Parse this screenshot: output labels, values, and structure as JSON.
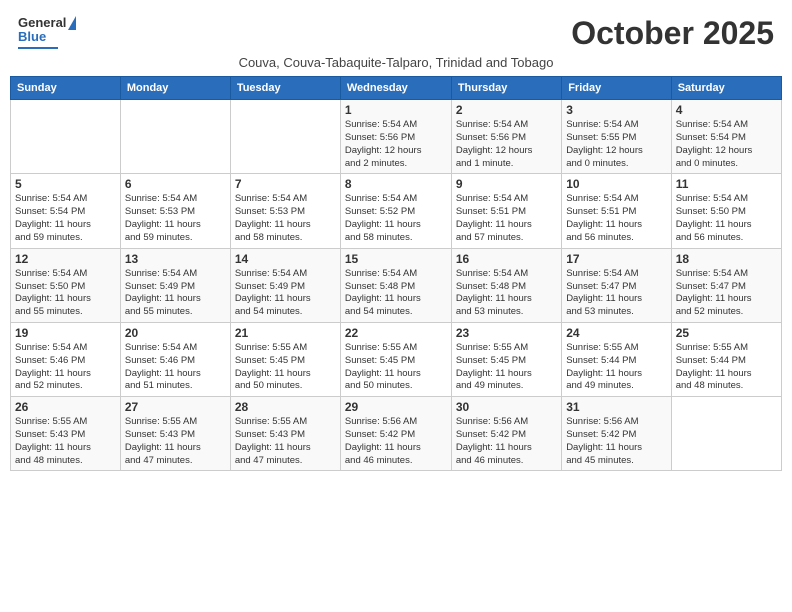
{
  "header": {
    "logo_line1": "General",
    "logo_line2": "Blue",
    "month": "October 2025",
    "subtitle": "Couva, Couva-Tabaquite-Talparo, Trinidad and Tobago"
  },
  "weekdays": [
    "Sunday",
    "Monday",
    "Tuesday",
    "Wednesday",
    "Thursday",
    "Friday",
    "Saturday"
  ],
  "weeks": [
    [
      {
        "day": "",
        "info": ""
      },
      {
        "day": "",
        "info": ""
      },
      {
        "day": "",
        "info": ""
      },
      {
        "day": "1",
        "info": "Sunrise: 5:54 AM\nSunset: 5:56 PM\nDaylight: 12 hours\nand 2 minutes."
      },
      {
        "day": "2",
        "info": "Sunrise: 5:54 AM\nSunset: 5:56 PM\nDaylight: 12 hours\nand 1 minute."
      },
      {
        "day": "3",
        "info": "Sunrise: 5:54 AM\nSunset: 5:55 PM\nDaylight: 12 hours\nand 0 minutes."
      },
      {
        "day": "4",
        "info": "Sunrise: 5:54 AM\nSunset: 5:54 PM\nDaylight: 12 hours\nand 0 minutes."
      }
    ],
    [
      {
        "day": "5",
        "info": "Sunrise: 5:54 AM\nSunset: 5:54 PM\nDaylight: 11 hours\nand 59 minutes."
      },
      {
        "day": "6",
        "info": "Sunrise: 5:54 AM\nSunset: 5:53 PM\nDaylight: 11 hours\nand 59 minutes."
      },
      {
        "day": "7",
        "info": "Sunrise: 5:54 AM\nSunset: 5:53 PM\nDaylight: 11 hours\nand 58 minutes."
      },
      {
        "day": "8",
        "info": "Sunrise: 5:54 AM\nSunset: 5:52 PM\nDaylight: 11 hours\nand 58 minutes."
      },
      {
        "day": "9",
        "info": "Sunrise: 5:54 AM\nSunset: 5:51 PM\nDaylight: 11 hours\nand 57 minutes."
      },
      {
        "day": "10",
        "info": "Sunrise: 5:54 AM\nSunset: 5:51 PM\nDaylight: 11 hours\nand 56 minutes."
      },
      {
        "day": "11",
        "info": "Sunrise: 5:54 AM\nSunset: 5:50 PM\nDaylight: 11 hours\nand 56 minutes."
      }
    ],
    [
      {
        "day": "12",
        "info": "Sunrise: 5:54 AM\nSunset: 5:50 PM\nDaylight: 11 hours\nand 55 minutes."
      },
      {
        "day": "13",
        "info": "Sunrise: 5:54 AM\nSunset: 5:49 PM\nDaylight: 11 hours\nand 55 minutes."
      },
      {
        "day": "14",
        "info": "Sunrise: 5:54 AM\nSunset: 5:49 PM\nDaylight: 11 hours\nand 54 minutes."
      },
      {
        "day": "15",
        "info": "Sunrise: 5:54 AM\nSunset: 5:48 PM\nDaylight: 11 hours\nand 54 minutes."
      },
      {
        "day": "16",
        "info": "Sunrise: 5:54 AM\nSunset: 5:48 PM\nDaylight: 11 hours\nand 53 minutes."
      },
      {
        "day": "17",
        "info": "Sunrise: 5:54 AM\nSunset: 5:47 PM\nDaylight: 11 hours\nand 53 minutes."
      },
      {
        "day": "18",
        "info": "Sunrise: 5:54 AM\nSunset: 5:47 PM\nDaylight: 11 hours\nand 52 minutes."
      }
    ],
    [
      {
        "day": "19",
        "info": "Sunrise: 5:54 AM\nSunset: 5:46 PM\nDaylight: 11 hours\nand 52 minutes."
      },
      {
        "day": "20",
        "info": "Sunrise: 5:54 AM\nSunset: 5:46 PM\nDaylight: 11 hours\nand 51 minutes."
      },
      {
        "day": "21",
        "info": "Sunrise: 5:55 AM\nSunset: 5:45 PM\nDaylight: 11 hours\nand 50 minutes."
      },
      {
        "day": "22",
        "info": "Sunrise: 5:55 AM\nSunset: 5:45 PM\nDaylight: 11 hours\nand 50 minutes."
      },
      {
        "day": "23",
        "info": "Sunrise: 5:55 AM\nSunset: 5:45 PM\nDaylight: 11 hours\nand 49 minutes."
      },
      {
        "day": "24",
        "info": "Sunrise: 5:55 AM\nSunset: 5:44 PM\nDaylight: 11 hours\nand 49 minutes."
      },
      {
        "day": "25",
        "info": "Sunrise: 5:55 AM\nSunset: 5:44 PM\nDaylight: 11 hours\nand 48 minutes."
      }
    ],
    [
      {
        "day": "26",
        "info": "Sunrise: 5:55 AM\nSunset: 5:43 PM\nDaylight: 11 hours\nand 48 minutes."
      },
      {
        "day": "27",
        "info": "Sunrise: 5:55 AM\nSunset: 5:43 PM\nDaylight: 11 hours\nand 47 minutes."
      },
      {
        "day": "28",
        "info": "Sunrise: 5:55 AM\nSunset: 5:43 PM\nDaylight: 11 hours\nand 47 minutes."
      },
      {
        "day": "29",
        "info": "Sunrise: 5:56 AM\nSunset: 5:42 PM\nDaylight: 11 hours\nand 46 minutes."
      },
      {
        "day": "30",
        "info": "Sunrise: 5:56 AM\nSunset: 5:42 PM\nDaylight: 11 hours\nand 46 minutes."
      },
      {
        "day": "31",
        "info": "Sunrise: 5:56 AM\nSunset: 5:42 PM\nDaylight: 11 hours\nand 45 minutes."
      },
      {
        "day": "",
        "info": ""
      }
    ]
  ]
}
